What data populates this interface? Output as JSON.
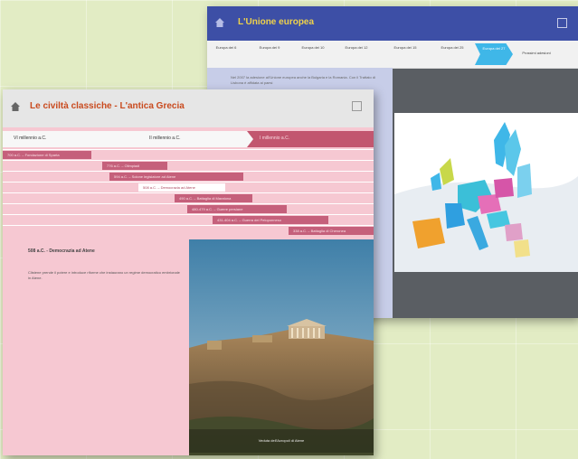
{
  "eu": {
    "title": "L'Unione europea",
    "tabs": [
      "Europa dei 6",
      "Europa dei 9",
      "Europa dei 10",
      "Europa dei 12",
      "Europa dei 15",
      "Europa dei 25",
      "Europa dei 27",
      "Prossimi adesioni"
    ],
    "active_tab": 6,
    "description": "Nel 2007 la adesione all'Unione europea anche la Bulgaria e la Romania. Con il Trattato di Lisbona è affidata ai paesi"
  },
  "greece": {
    "title": "Le civiltà classiche - L'antica Grecia",
    "periods": [
      "VI millennio a.C.",
      "II millennio a.C.",
      "I millennio a.C."
    ],
    "active_period": 2,
    "timeline": [
      {
        "label": "700 a.C. – Fondazione di Sparta",
        "sel": false
      },
      {
        "label": "776 a.C. – Olimpiadi",
        "sel": false
      },
      {
        "label": "594 a.C. – Solone legislatore ad Atene",
        "sel": false
      },
      {
        "label": "508 a.C. – Democrazia ad Atene",
        "sel": true
      },
      {
        "label": "490 a.C. – Battaglia di Maratona",
        "sel": false
      },
      {
        "label": "480-479 a.C. – Guerre persiane",
        "sel": false
      },
      {
        "label": "431-404 a.C. – Guerra del Peloponneso",
        "sel": false
      },
      {
        "label": "338 a.C. – Battaglia di Cheronea",
        "sel": false
      }
    ],
    "event_title": "508 a.C. - Democrazia ad Atene",
    "event_text": "Clistene prende il potere e introduce riforme che instaurano un regime democratico embrionale in Atene.",
    "photo_caption": "Veduta dell'Acropoli di Atene"
  },
  "colors": {
    "eu_titlebar": "#3d4fa6",
    "eu_accent": "#3fb7e8",
    "greece_accent": "#c5607b",
    "greece_title": "#c94a1e"
  }
}
